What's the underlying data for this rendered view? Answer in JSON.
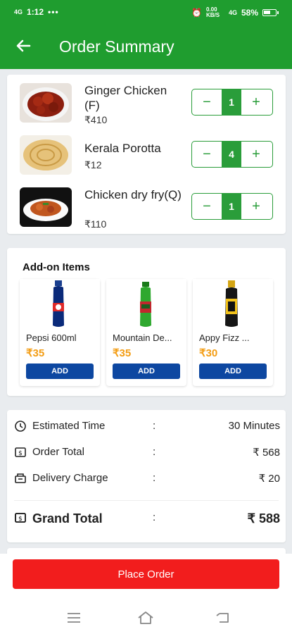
{
  "status_bar": {
    "time": "1:12",
    "network_left": "4G",
    "speed": "0.00 KB/S",
    "network_right": "4G",
    "battery": "58%",
    "battery_level": 0.58
  },
  "app_bar": {
    "title": "Order Summary"
  },
  "cart_items": [
    {
      "name": "Ginger Chicken (F)",
      "price": "₹410",
      "qty": "1"
    },
    {
      "name": "Kerala Porotta",
      "price": "₹12",
      "qty": "4"
    },
    {
      "name": "Chicken dry fry(Q)",
      "price": "₹110",
      "qty": "1"
    }
  ],
  "stepper": {
    "minus": "−",
    "plus": "+"
  },
  "addons": {
    "title": "Add-on Items",
    "items": [
      {
        "name": "Pepsi 600ml",
        "price": "₹35",
        "button": "ADD"
      },
      {
        "name": "Mountain De...",
        "price": "₹35",
        "button": "ADD"
      },
      {
        "name": "Appy Fizz ...",
        "price": "₹30",
        "button": "ADD"
      }
    ]
  },
  "summary": {
    "estimated_time_label": "Estimated Time",
    "estimated_time_value": "30 Minutes",
    "order_total_label": "Order Total",
    "order_total_value": "₹ 568",
    "delivery_label": "Delivery Charge",
    "delivery_value": "₹ 20",
    "grand_total_label": "Grand Total",
    "grand_total_value": "₹ 588",
    "colon": ":"
  },
  "place_order": {
    "label": "Place Order"
  },
  "colors": {
    "primary": "#1f9d2f",
    "accent": "#2a9d3a",
    "add_button": "#0d47a1",
    "price_orange": "#f39c12",
    "place_order": "#f21d1d"
  }
}
